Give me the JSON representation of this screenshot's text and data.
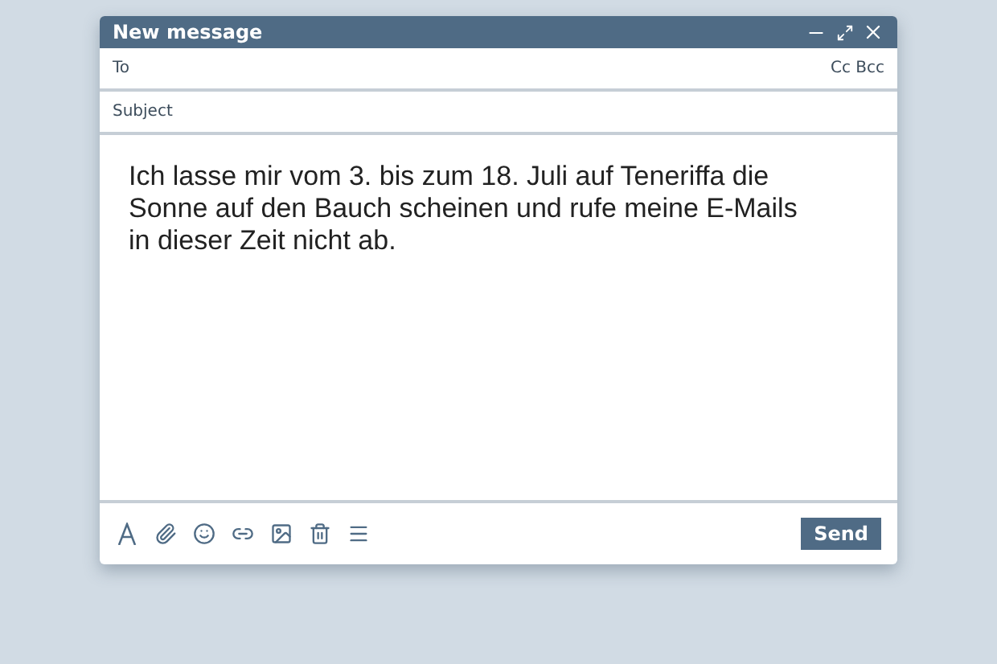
{
  "window": {
    "title": "New message"
  },
  "to": {
    "label": "To",
    "cc_bcc": "Cc Bcc"
  },
  "subject": {
    "label": "Subject"
  },
  "body": "Ich lasse mir vom 3. bis zum 18. Juli auf Teneriffa die Sonne auf den Bauch scheinen und rufe meine E-Mails in dieser Zeit nicht ab.",
  "toolbar": {
    "tools": [
      {
        "kind": "format"
      },
      {
        "kind": "attach"
      },
      {
        "kind": "emoji"
      },
      {
        "kind": "link"
      },
      {
        "kind": "image"
      },
      {
        "kind": "trash"
      },
      {
        "kind": "more"
      }
    ],
    "send": "Send"
  }
}
